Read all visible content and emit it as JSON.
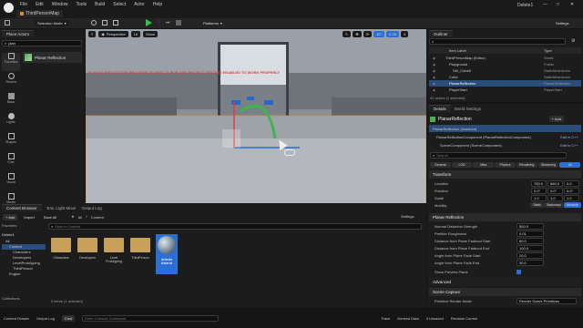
{
  "titlebar": {
    "menus": [
      "File",
      "Edit",
      "Window",
      "Tools",
      "Build",
      "Select",
      "Actor",
      "Help"
    ],
    "tab": "ThirdPersonMap",
    "project": "Delete1",
    "win_min": "—",
    "win_max": "□",
    "win_close": "✕"
  },
  "toolbar": {
    "mode": "Selection Mode",
    "platforms": "Platforms",
    "settings": "Settings"
  },
  "place_actors": {
    "tab": "Place Actors",
    "search": "plan",
    "result": "Planar Reflection",
    "categories": [
      "Favorites",
      "Recent",
      "Basic",
      "Lights",
      "Shapes",
      "Cine",
      "Visual",
      "Media",
      "More"
    ]
  },
  "viewport": {
    "perspective": "Perspective",
    "lit": "Lit",
    "show": "Show",
    "snap_angle": "10°",
    "snap_scale": "0.25",
    "cam_speed": "4",
    "warning": "PLANAR REFLECTION REQUIRES GLOBAL CLIP PLANE PROJECT SETTING ENABLED TO WORK PROPERLY"
  },
  "outliner": {
    "tab": "Outliner",
    "col_label": "Item Label",
    "col_type": "Type",
    "rows": [
      {
        "label": "ThirdPersonMap (Editor)",
        "type": "World",
        "indent": 1,
        "sel": false
      },
      {
        "label": "Playground",
        "type": "Folder",
        "indent": 2,
        "sel": false
      },
      {
        "label": "SM_Cube6",
        "type": "StaticMeshActor",
        "indent": 3,
        "sel": false
      },
      {
        "label": "Cube",
        "type": "StaticMeshActor",
        "indent": 2,
        "sel": false
      },
      {
        "label": "PlanarReflection",
        "type": "PlanarReflection",
        "indent": 2,
        "sel": true
      },
      {
        "label": "PlayerStart",
        "type": "PlayerStart",
        "indent": 2,
        "sel": false
      }
    ],
    "footer": "42 actors (1 selected)"
  },
  "details": {
    "tab": "Details",
    "tab2": "World Settings",
    "actor_name": "PlanarReflection",
    "add": "+ Add",
    "instance": "PlanarReflection (Instance)",
    "comp1": "PlanarReflectionComponent (PlanarReflectionComponent)",
    "comp1_edit": "Edit in C++",
    "comp2": "SceneComponent (SceneComponent)",
    "comp2_edit": "Edit in C++",
    "search": "Search",
    "filter_tabs": [
      "General",
      "LOD",
      "Misc",
      "Physics",
      "Rendering",
      "Streaming",
      "All"
    ],
    "transform": {
      "title": "Transform",
      "location_label": "Location",
      "location": [
        "750.0",
        "660.0",
        "0.0"
      ],
      "rotation_label": "Rotation",
      "rotation": [
        "0.0°",
        "0.0°",
        "0.0°"
      ],
      "scale_label": "Scale",
      "scale": [
        "1.0",
        "1.0",
        "1.0"
      ],
      "mobility_label": "Mobility",
      "mobility": [
        "Static",
        "Stationary",
        "Movable"
      ]
    },
    "planar": {
      "title": "Planar Reflection",
      "rows": [
        {
          "label": "Normal Distortion Strength",
          "value": "500.0"
        },
        {
          "label": "Prefilter Roughness",
          "value": "0.01"
        },
        {
          "label": "Distance from Plane Fadeout Start",
          "value": "60.0"
        },
        {
          "label": "Distance from Plane Fadeout End",
          "value": "100.0"
        },
        {
          "label": "Angle from Plane Fade Start",
          "value": "20.0"
        },
        {
          "label": "Angle from Plane Fade End",
          "value": "30.0"
        }
      ],
      "show_preview_label": "Show Preview Plane"
    },
    "advanced": "Advanced",
    "scene_capture": "Scene Capture",
    "primitive_mode_label": "Primitive Render Mode",
    "primitive_mode": "Render Scene Primitives"
  },
  "content_browser": {
    "tab": "Content Browser",
    "tab2": "Env. Light Mixer",
    "tab3": "Output Log",
    "add": "+ Add",
    "import": "Import",
    "save_all": "Save All",
    "path": [
      "All",
      "Content"
    ],
    "settings": "Settings",
    "favorites": "Favorites",
    "project": "Delete1",
    "tree": [
      "All",
      "Content",
      "Characters",
      "Developers",
      "LevelPrototyping",
      "ThirdPerson",
      "Engine"
    ],
    "search": "Search Content",
    "items": [
      {
        "name": "Characters",
        "kind": "folder"
      },
      {
        "name": "Developers",
        "kind": "folder-person"
      },
      {
        "name": "Level Prototyping",
        "kind": "folder"
      },
      {
        "name": "ThirdPerson",
        "kind": "folder"
      },
      {
        "name": "defaults Material",
        "kind": "sphere",
        "sel": true
      }
    ],
    "collections": "Collections",
    "status": "5 items (1 selected)"
  },
  "statusbar": {
    "content_drawer": "Content Drawer",
    "output_log": "Output Log",
    "cmd": "Cmd",
    "console_placeholder": "Enter Console Command",
    "trace": "Trace",
    "derived": "Derived Data",
    "unsaved": "3 Unsaved",
    "revision": "Revision Control"
  },
  "colors": {
    "accent": "#2a6fd6",
    "selected_row": "#2a4d7a",
    "warning": "#e0413a",
    "folder": "#c9a05a",
    "play": "#36c24a"
  }
}
